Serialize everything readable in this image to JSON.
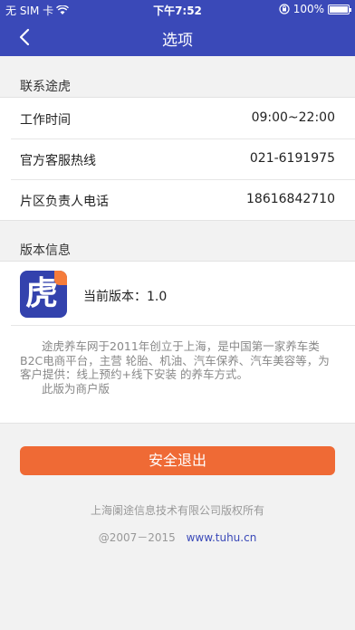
{
  "status_bar": {
    "carrier": "无 SIM 卡",
    "time": "下午7:52",
    "battery": "100%"
  },
  "nav": {
    "title": "选项"
  },
  "contact": {
    "section_title": "联系途虎",
    "rows": [
      {
        "label": "工作时间",
        "value": "09:00~22:00"
      },
      {
        "label": "官方客服热线",
        "value": "021-6191975"
      },
      {
        "label": "片区负责人电话",
        "value": "18616842710"
      }
    ]
  },
  "version_info": {
    "section_title": "版本信息",
    "logo_char": "虎",
    "current_version": "当前版本：1.0",
    "description_1": "途虎养车网于2011年创立于上海，是中国第一家养车类B2C电商平台，主营 轮胎、机油、汽车保养、汽车美容等，为客户提供：线上预约+线下安装 的养车方式。",
    "description_2": "此版为商户版"
  },
  "logout_label": "安全退出",
  "footer": {
    "copyright": "上海阑途信息技术有限公司版权所有",
    "years": "@2007－2015",
    "website": "www.tuhu.cn"
  },
  "colors": {
    "primary": "#3a49b8",
    "accent": "#ef6a35"
  }
}
